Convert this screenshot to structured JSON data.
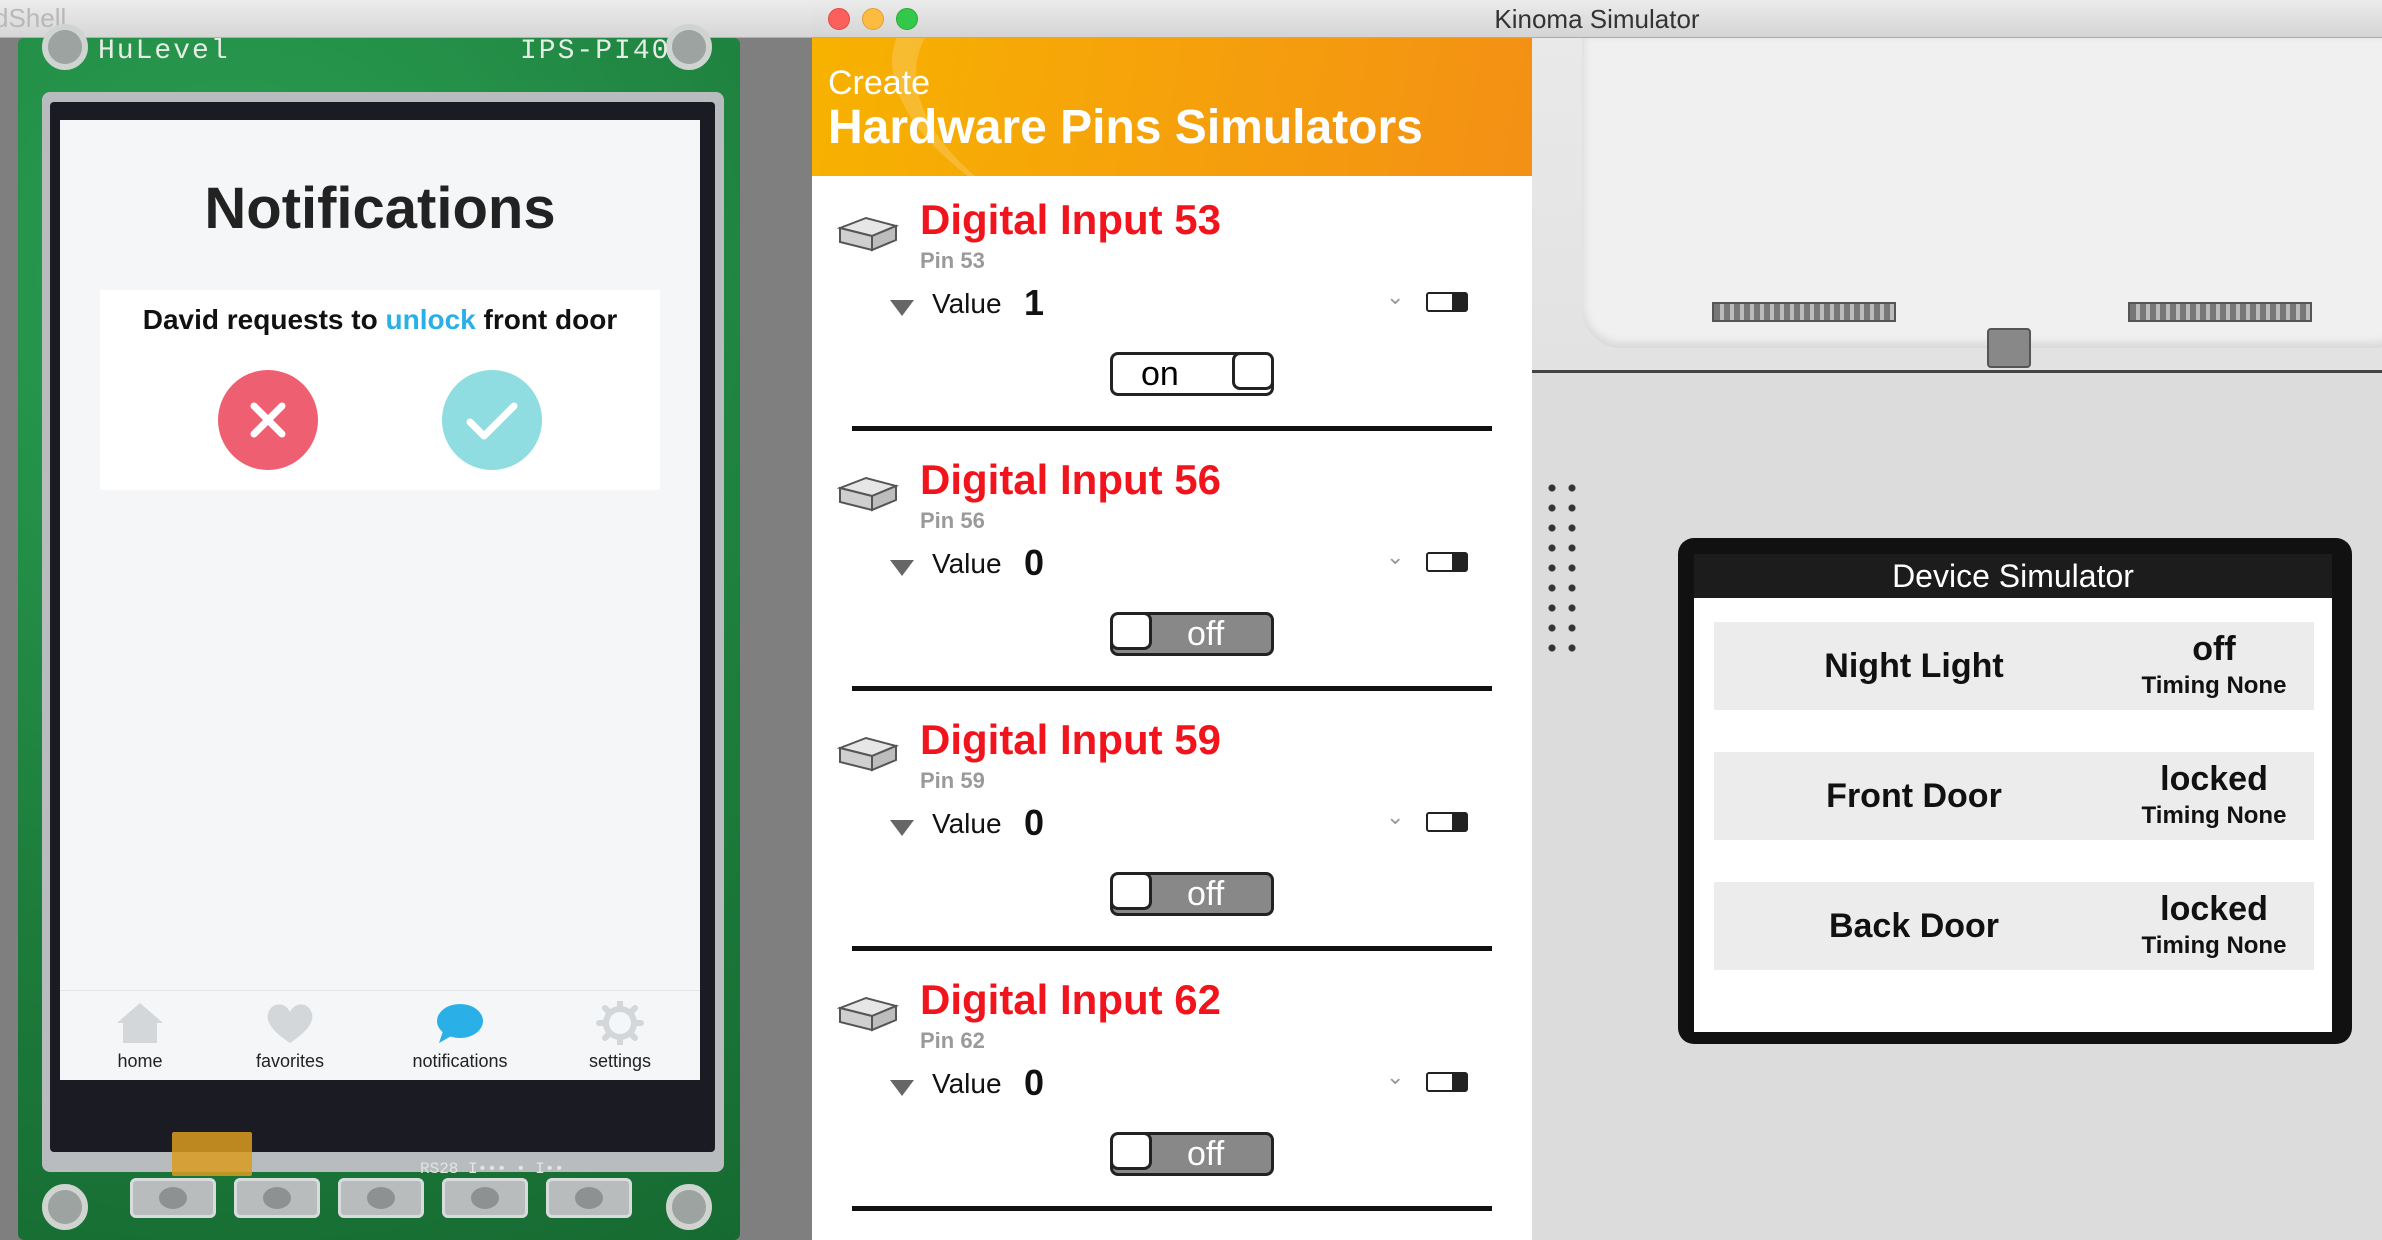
{
  "left_window": {
    "title": "dShell",
    "pcb_label_left": "HuLevel",
    "pcb_label_right": "IPS-PI40",
    "pcb_bottom_text": "RS28 I••• • I••",
    "app": {
      "title": "Notifications",
      "card": {
        "message_prefix": "David requests to ",
        "message_action": "unlock",
        "message_suffix": " front door",
        "reject_icon": "close-icon",
        "accept_icon": "check-icon"
      },
      "tabs": [
        {
          "label": "home",
          "icon": "home-icon",
          "active": false
        },
        {
          "label": "favorites",
          "icon": "heart-icon",
          "active": false
        },
        {
          "label": "notifications",
          "icon": "chat-bubble-icon",
          "active": true
        },
        {
          "label": "settings",
          "icon": "gear-icon",
          "active": false
        }
      ]
    }
  },
  "right_window": {
    "title": "Kinoma Simulator",
    "pins_header": {
      "create": "Create",
      "title": "Hardware Pins Simulators"
    },
    "pins": [
      {
        "name": "Digital Input 53",
        "pin": "Pin 53",
        "value_label": "Value",
        "value": "1",
        "switch": "on"
      },
      {
        "name": "Digital Input 56",
        "pin": "Pin 56",
        "value_label": "Value",
        "value": "0",
        "switch": "off"
      },
      {
        "name": "Digital Input 59",
        "pin": "Pin 59",
        "value_label": "Value",
        "value": "0",
        "switch": "off"
      },
      {
        "name": "Digital Input 62",
        "pin": "Pin 62",
        "value_label": "Value",
        "value": "0",
        "switch": "off"
      }
    ],
    "device": {
      "header": "Device Simulator",
      "rows": [
        {
          "name": "Night Light",
          "state": "off",
          "timing": "Timing None"
        },
        {
          "name": "Front Door",
          "state": "locked",
          "timing": "Timing None"
        },
        {
          "name": "Back Door",
          "state": "locked",
          "timing": "Timing None"
        }
      ]
    }
  },
  "colors": {
    "pin_name": "#f1141d",
    "header_orange": "#f6a30a",
    "reject_red": "#ef5f72",
    "accept_teal": "#8fdde0",
    "unlock_blue": "#2ab0e6",
    "notif_active_blue": "#2ab0e6"
  }
}
